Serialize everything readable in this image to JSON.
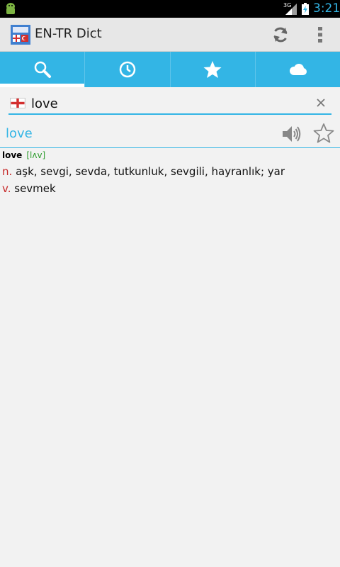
{
  "status_bar": {
    "network": "3G",
    "time": "3:21"
  },
  "app": {
    "title": "EN-TR Dict"
  },
  "tabs": [
    {
      "name": "search-icon",
      "active": true
    },
    {
      "name": "history-icon",
      "active": false
    },
    {
      "name": "favorites-icon",
      "active": false
    },
    {
      "name": "cloud-icon",
      "active": false
    }
  ],
  "search": {
    "value": "love",
    "placeholder": ""
  },
  "entry": {
    "word": "love",
    "headword": "love",
    "pronunciation": "[lʌv]",
    "senses": [
      {
        "pos": "n.",
        "text": "aşk, sevgi, sevda, tutkunluk, sevgili, hayranlık; yar"
      },
      {
        "pos": "v.",
        "text": "sevmek"
      }
    ]
  },
  "colors": {
    "accent": "#33b5e5",
    "pos": "#c62828",
    "pronunciation": "#2e9d2e"
  }
}
